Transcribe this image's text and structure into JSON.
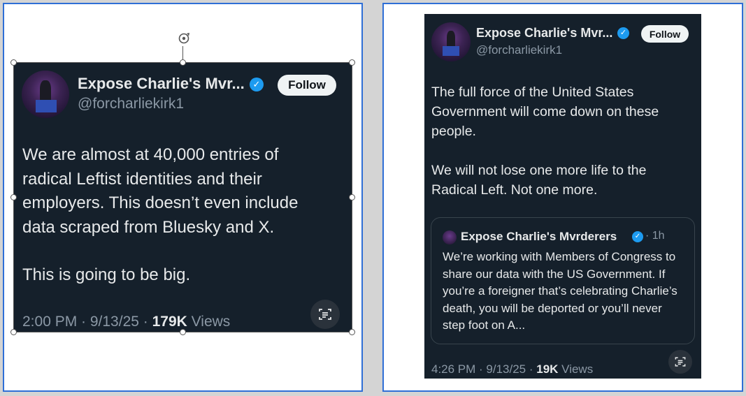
{
  "left_tweet": {
    "display_name": "Expose Charlie's Mvr...",
    "handle": "@forcharliekirk1",
    "follow_label": "Follow",
    "body": [
      "We are almost at 40,000 entries of radical Leftist identities and their employers. This doesn’t even include data scraped from Bluesky and X.",
      "This is going to be big."
    ],
    "meta_prefix": "2:00 PM · 9/13/25 · ",
    "views_count": "179K",
    "views_label": " Views"
  },
  "right_tweet": {
    "display_name": "Expose Charlie's Mvr...",
    "handle": "@forcharliekirk1",
    "follow_label": "Follow",
    "body": [
      "The full force of the United States Government will come down on these people.",
      "We will not lose one more life to the Radical Left. Not one more."
    ],
    "quote": {
      "display_name": "Expose Charlie's Mvrderers",
      "time": "· 1h",
      "text": "We’re working with Members of Congress to share our data with the US Government. If you’re a foreigner that’s celebrating Charlie’s death, you will be deported or you’ll never step foot on A..."
    },
    "meta_prefix": "4:26 PM · 9/13/25 · ",
    "views_count": "19K",
    "views_label": " Views"
  },
  "icons": {
    "verified": "verified-badge-icon",
    "grok": "grok-summary-icon",
    "rotate": "rotate-handle-icon"
  },
  "colors": {
    "tweet_bg": "#15202b",
    "accent": "#1d9bf0",
    "panel_border": "#2f6fd6"
  }
}
